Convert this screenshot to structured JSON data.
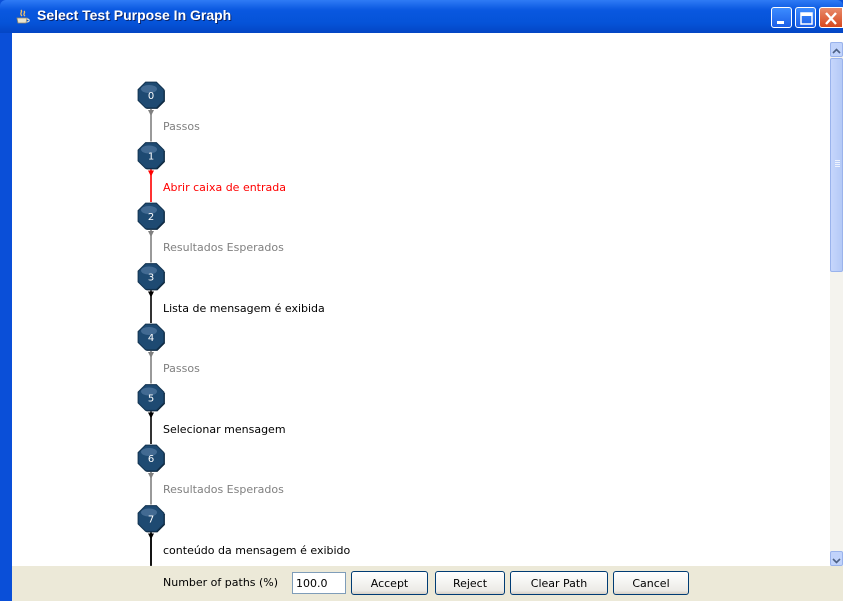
{
  "window": {
    "title": "Select Test Purpose In Graph"
  },
  "graph": {
    "nodes": [
      "0",
      "1",
      "2",
      "3",
      "4",
      "5",
      "6",
      "7"
    ],
    "edges": [
      {
        "label": "Passos",
        "color": "#808080"
      },
      {
        "label": "Abrir caixa de entrada",
        "color": "#ff0000"
      },
      {
        "label": "Resultados Esperados",
        "color": "#808080"
      },
      {
        "label": "Lista de mensagem é exibida",
        "color": "#000000"
      },
      {
        "label": "Passos",
        "color": "#808080"
      },
      {
        "label": "Selecionar mensagem",
        "color": "#000000"
      },
      {
        "label": "Resultados Esperados",
        "color": "#808080"
      },
      {
        "label": "conteúdo da mensagem é exibido",
        "color": "#000000"
      }
    ]
  },
  "bottom": {
    "paths_label": "Number of paths (%)",
    "paths_value": "100.0",
    "accept": "Accept",
    "reject": "Reject",
    "clear_path": "Clear Path",
    "cancel": "Cancel"
  },
  "colors": {
    "node_fill": "#1e4a72",
    "titlebar": "#0553d8"
  }
}
